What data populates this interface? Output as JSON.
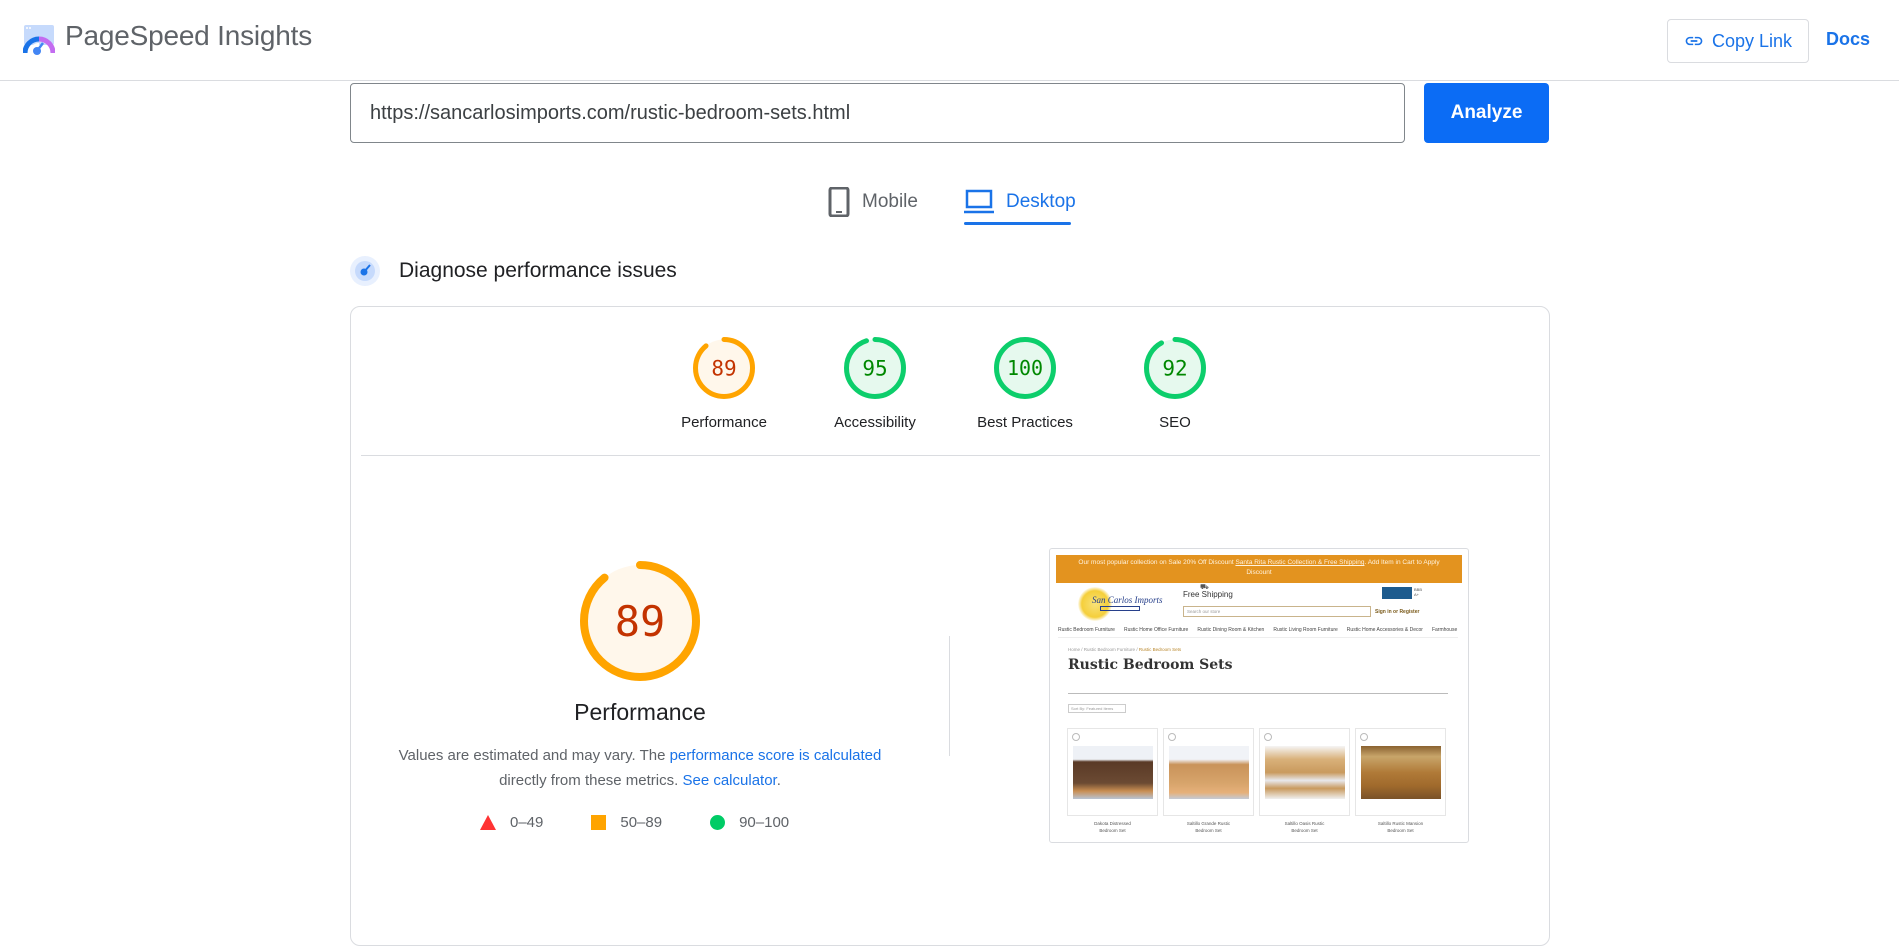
{
  "header": {
    "brand": "PageSpeed Insights",
    "copy_link_label": "Copy Link",
    "docs_label": "Docs"
  },
  "url_bar": {
    "value": "https://sancarlosimports.com/rustic-bedroom-sets.html",
    "analyze_label": "Analyze"
  },
  "tabs": [
    {
      "label": "Mobile",
      "icon": "smartphone-icon",
      "active": false
    },
    {
      "label": "Desktop",
      "icon": "laptop-icon",
      "active": true
    }
  ],
  "section": {
    "title": "Diagnose performance issues",
    "icon": "diagnose-gauge-icon"
  },
  "scores": [
    {
      "label": "Performance",
      "value": 89,
      "status": "average"
    },
    {
      "label": "Accessibility",
      "value": 95,
      "status": "pass"
    },
    {
      "label": "Best Practices",
      "value": 100,
      "status": "pass"
    },
    {
      "label": "SEO",
      "value": 92,
      "status": "pass"
    }
  ],
  "performance": {
    "score": 89,
    "label": "Performance",
    "description_prefix": "Values are estimated and may vary. The ",
    "description_link1": "performance score is calculated",
    "description_middle": " directly from these metrics. ",
    "description_link2": "See calculator",
    "description_suffix": "."
  },
  "legend": [
    {
      "shape": "triangle",
      "range": "0–49",
      "color": "#ff3333"
    },
    {
      "shape": "square",
      "range": "50–89",
      "color": "#ffa400"
    },
    {
      "shape": "circle",
      "range": "90–100",
      "color": "#00cc66"
    }
  ],
  "colors": {
    "accent": "#1a73e8",
    "analyze_button": "#0b6cf5",
    "pass_stroke": "#0cce6b",
    "pass_fill": "#e6f9ee",
    "pass_text": "#008800",
    "average_stroke": "#ffa400",
    "average_fill": "#fff7eb",
    "average_text": "#c33300"
  },
  "screenshot": {
    "banner_prefix": "Our most popular collection on Sale 20% Off Discount ",
    "banner_link": "Santa Rita Rustic Collection & Free Shipping",
    "banner_suffix": ". Add Item in Cart to Apply Discount",
    "logo_text": "San Carlos Imports",
    "logo_sub": "Rustic Furniture",
    "shipping": "Free Shipping",
    "search_placeholder": "Search our store",
    "signin": "Sign in or Register",
    "nav": [
      "Rustic Bedroom Furniture",
      "Rustic Home Office Furniture",
      "Rustic Dining Room & Kitchen",
      "Rustic Living Room Furniture",
      "Rustic Home Accessories & Decor",
      "Farmhouse F..."
    ],
    "breadcrumb": [
      "Home",
      "Rustic Bedroom Furniture",
      "Rustic Bedroom Sets"
    ],
    "page_title": "Rustic Bedroom Sets",
    "sort_label": "Sort By: Featured Items",
    "products": [
      {
        "name_line1": "Dakota Distressed",
        "name_line2": "Bedroom Set"
      },
      {
        "name_line1": "Saltillo Grande Rustic",
        "name_line2": "Bedroom Set"
      },
      {
        "name_line1": "Saltillo Oasis Rustic",
        "name_line2": "Bedroom Set"
      },
      {
        "name_line1": "Saltillo Rustic Mansion",
        "name_line2": "Bedroom Set"
      }
    ]
  }
}
